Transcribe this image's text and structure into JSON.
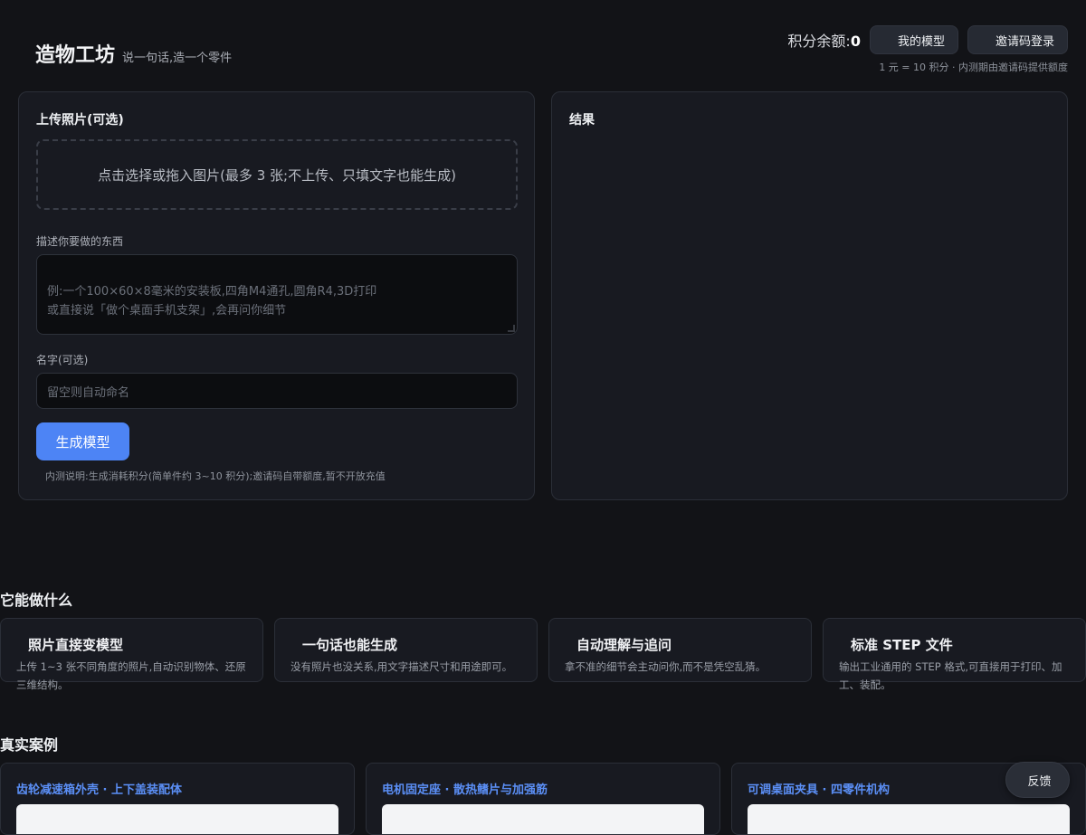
{
  "header": {
    "title": "造物工坊",
    "tagline": "说一句话,造一个零件",
    "credits_label": "积分余额:",
    "credits_value": "0",
    "my_models_label": "我的模型",
    "invite_login_label": "邀请码登录",
    "rate_note": "1 元 = 10 积分 · 内测期由邀请码提供额度"
  },
  "form": {
    "upload_title": "上传照片(可选)",
    "dropzone_text": "点击选择或拖入图片(最多 3 张;不上传、只填文字也能生成)",
    "describe_label": "描述你要做的东西",
    "describe_placeholder": "例:一个100×60×8毫米的安装板,四角M4通孔,圆角R4,3D打印\n或直接说「做个桌面手机支架」,会再问你细节",
    "name_label": "名字(可选)",
    "name_placeholder": "留空则自动命名",
    "generate_label": "生成模型",
    "beta_note": "内测说明:生成消耗积分(简单件约 3~10 积分);邀请码自带额度,暂不开放充值"
  },
  "result": {
    "title": "结果"
  },
  "features": {
    "title": "它能做什么",
    "items": [
      {
        "title": "照片直接变模型",
        "desc": "上传 1~3 张不同角度的照片,自动识别物体、还原三维结构。"
      },
      {
        "title": "一句话也能生成",
        "desc": "没有照片也没关系,用文字描述尺寸和用途即可。"
      },
      {
        "title": "自动理解与追问",
        "desc": "拿不准的细节会主动问你,而不是凭空乱猜。"
      },
      {
        "title": "标准 STEP 文件",
        "desc": "输出工业通用的 STEP 格式,可直接用于打印、加工、装配。"
      }
    ]
  },
  "cases": {
    "title": "真实案例",
    "items": [
      {
        "title": "齿轮减速箱外壳 · 上下盖装配体"
      },
      {
        "title": "电机固定座 · 散热鳍片与加强筋"
      },
      {
        "title": "可调桌面夹具 · 四零件机构"
      }
    ]
  },
  "feedback": {
    "label": "反馈"
  }
}
